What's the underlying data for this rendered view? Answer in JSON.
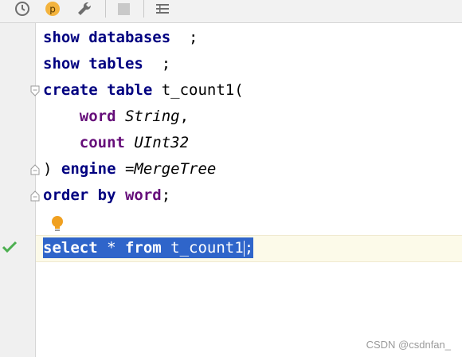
{
  "toolbar": {
    "icons": [
      "history-icon",
      "profile-p-icon",
      "wrench-icon",
      "stop-icon",
      "table-format-icon"
    ],
    "p_label": "p"
  },
  "editor": {
    "lines": [
      {
        "parts": [
          [
            "kw",
            "show databases"
          ],
          [
            "",
            "  ;"
          ]
        ]
      },
      {
        "parts": [
          [
            "kw",
            "show tables"
          ],
          [
            "",
            "  ;"
          ]
        ]
      },
      {
        "parts": [
          [
            "kw",
            "create table"
          ],
          [
            "",
            " t_count1("
          ]
        ]
      },
      {
        "parts": [
          [
            "",
            "    "
          ],
          [
            "kwp",
            "word"
          ],
          [
            "",
            " "
          ],
          [
            "ty",
            "String"
          ],
          [
            "",
            ","
          ]
        ]
      },
      {
        "parts": [
          [
            "",
            "    "
          ],
          [
            "kwp",
            "count"
          ],
          [
            "",
            " "
          ],
          [
            "ty",
            "UInt32"
          ]
        ]
      },
      {
        "parts": [
          [
            "",
            ") "
          ],
          [
            "kw",
            "engine"
          ],
          [
            "",
            " ="
          ],
          [
            "ty",
            "MergeTree"
          ]
        ]
      },
      {
        "parts": [
          [
            "kw",
            "order by"
          ],
          [
            "",
            " "
          ],
          [
            "kwp",
            "word"
          ],
          [
            "",
            ";"
          ]
        ]
      },
      {
        "parts": [
          [
            "",
            ""
          ]
        ]
      },
      {
        "parts": [
          [
            "kw",
            "select"
          ],
          [
            "",
            " * "
          ],
          [
            "kw",
            "from"
          ],
          [
            "",
            " t_count1"
          ]
        ],
        "caret_after": ";"
      }
    ]
  },
  "watermark": "CSDN @csdnfan_",
  "colors": {
    "keyword": "#000080",
    "identifier": "#660e7a",
    "selection": "#2f65ca",
    "gutter": "#f0f0f0",
    "check": "#4caf50",
    "bulb": "#f0a020"
  }
}
